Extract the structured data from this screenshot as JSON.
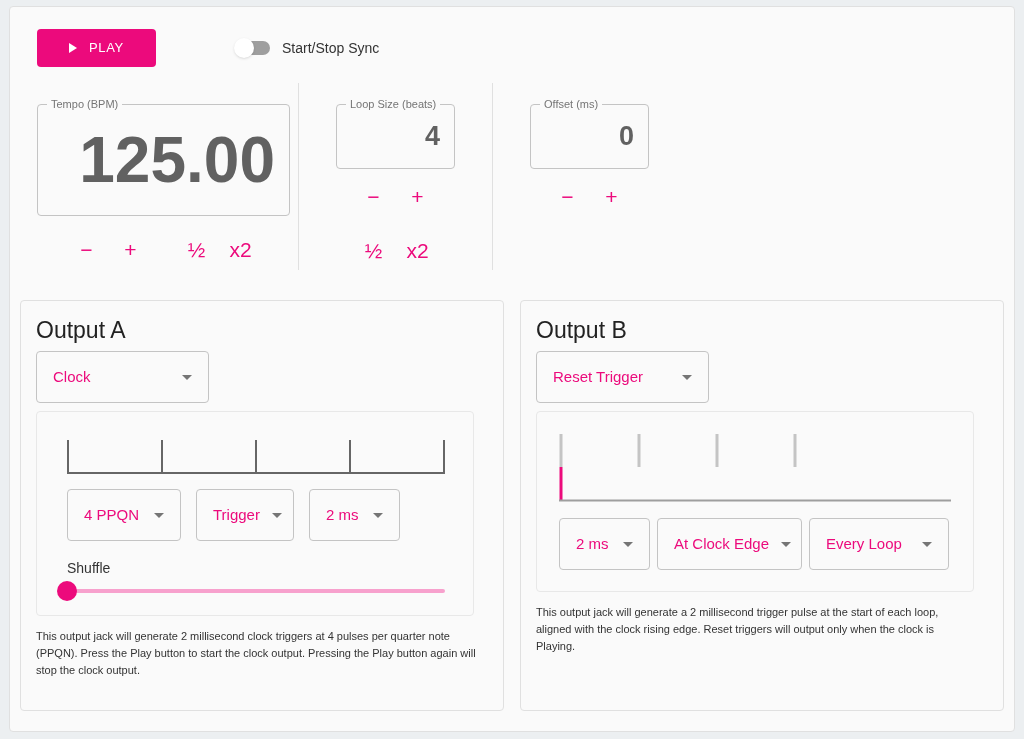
{
  "play_button": {
    "label": "PLAY"
  },
  "sync_switch": {
    "label": "Start/Stop Sync",
    "on": false
  },
  "fields": [
    {
      "label": "Tempo (BPM)",
      "value": "125.00",
      "kind": "large",
      "button_rows": [
        [
          "−",
          "+",
          "½",
          "x2"
        ]
      ]
    },
    {
      "label": "Loop Size (beats)",
      "value": "4",
      "kind": "small",
      "button_rows": [
        [
          "−",
          "+"
        ],
        [
          "½",
          "x2"
        ]
      ]
    },
    {
      "label": "Offset (ms)",
      "value": "0",
      "kind": "small",
      "button_rows": [
        [
          "−",
          "+"
        ]
      ]
    }
  ],
  "outputs": [
    {
      "title": "Output A",
      "mode": "Clock",
      "kind": "clock",
      "selects": [
        "4 PPQN",
        "Trigger",
        "2 ms"
      ],
      "slider": {
        "label": "Shuffle",
        "level": 0
      },
      "description": "This output jack will generate 2 millisecond clock triggers at 4 pulses per quarter note (PPQN). Press the Play button to start the clock output. Pressing the Play button again will stop the clock output."
    },
    {
      "title": "Output B",
      "mode": "Reset Trigger",
      "kind": "reset",
      "selects": [
        "2 ms",
        "At Clock Edge",
        "Every Loop"
      ],
      "description": "This output jack will generate a 2 millisecond trigger pulse at the start of each loop, aligned with the clock rising edge. Reset triggers will output only when the clock is Playing."
    }
  ]
}
